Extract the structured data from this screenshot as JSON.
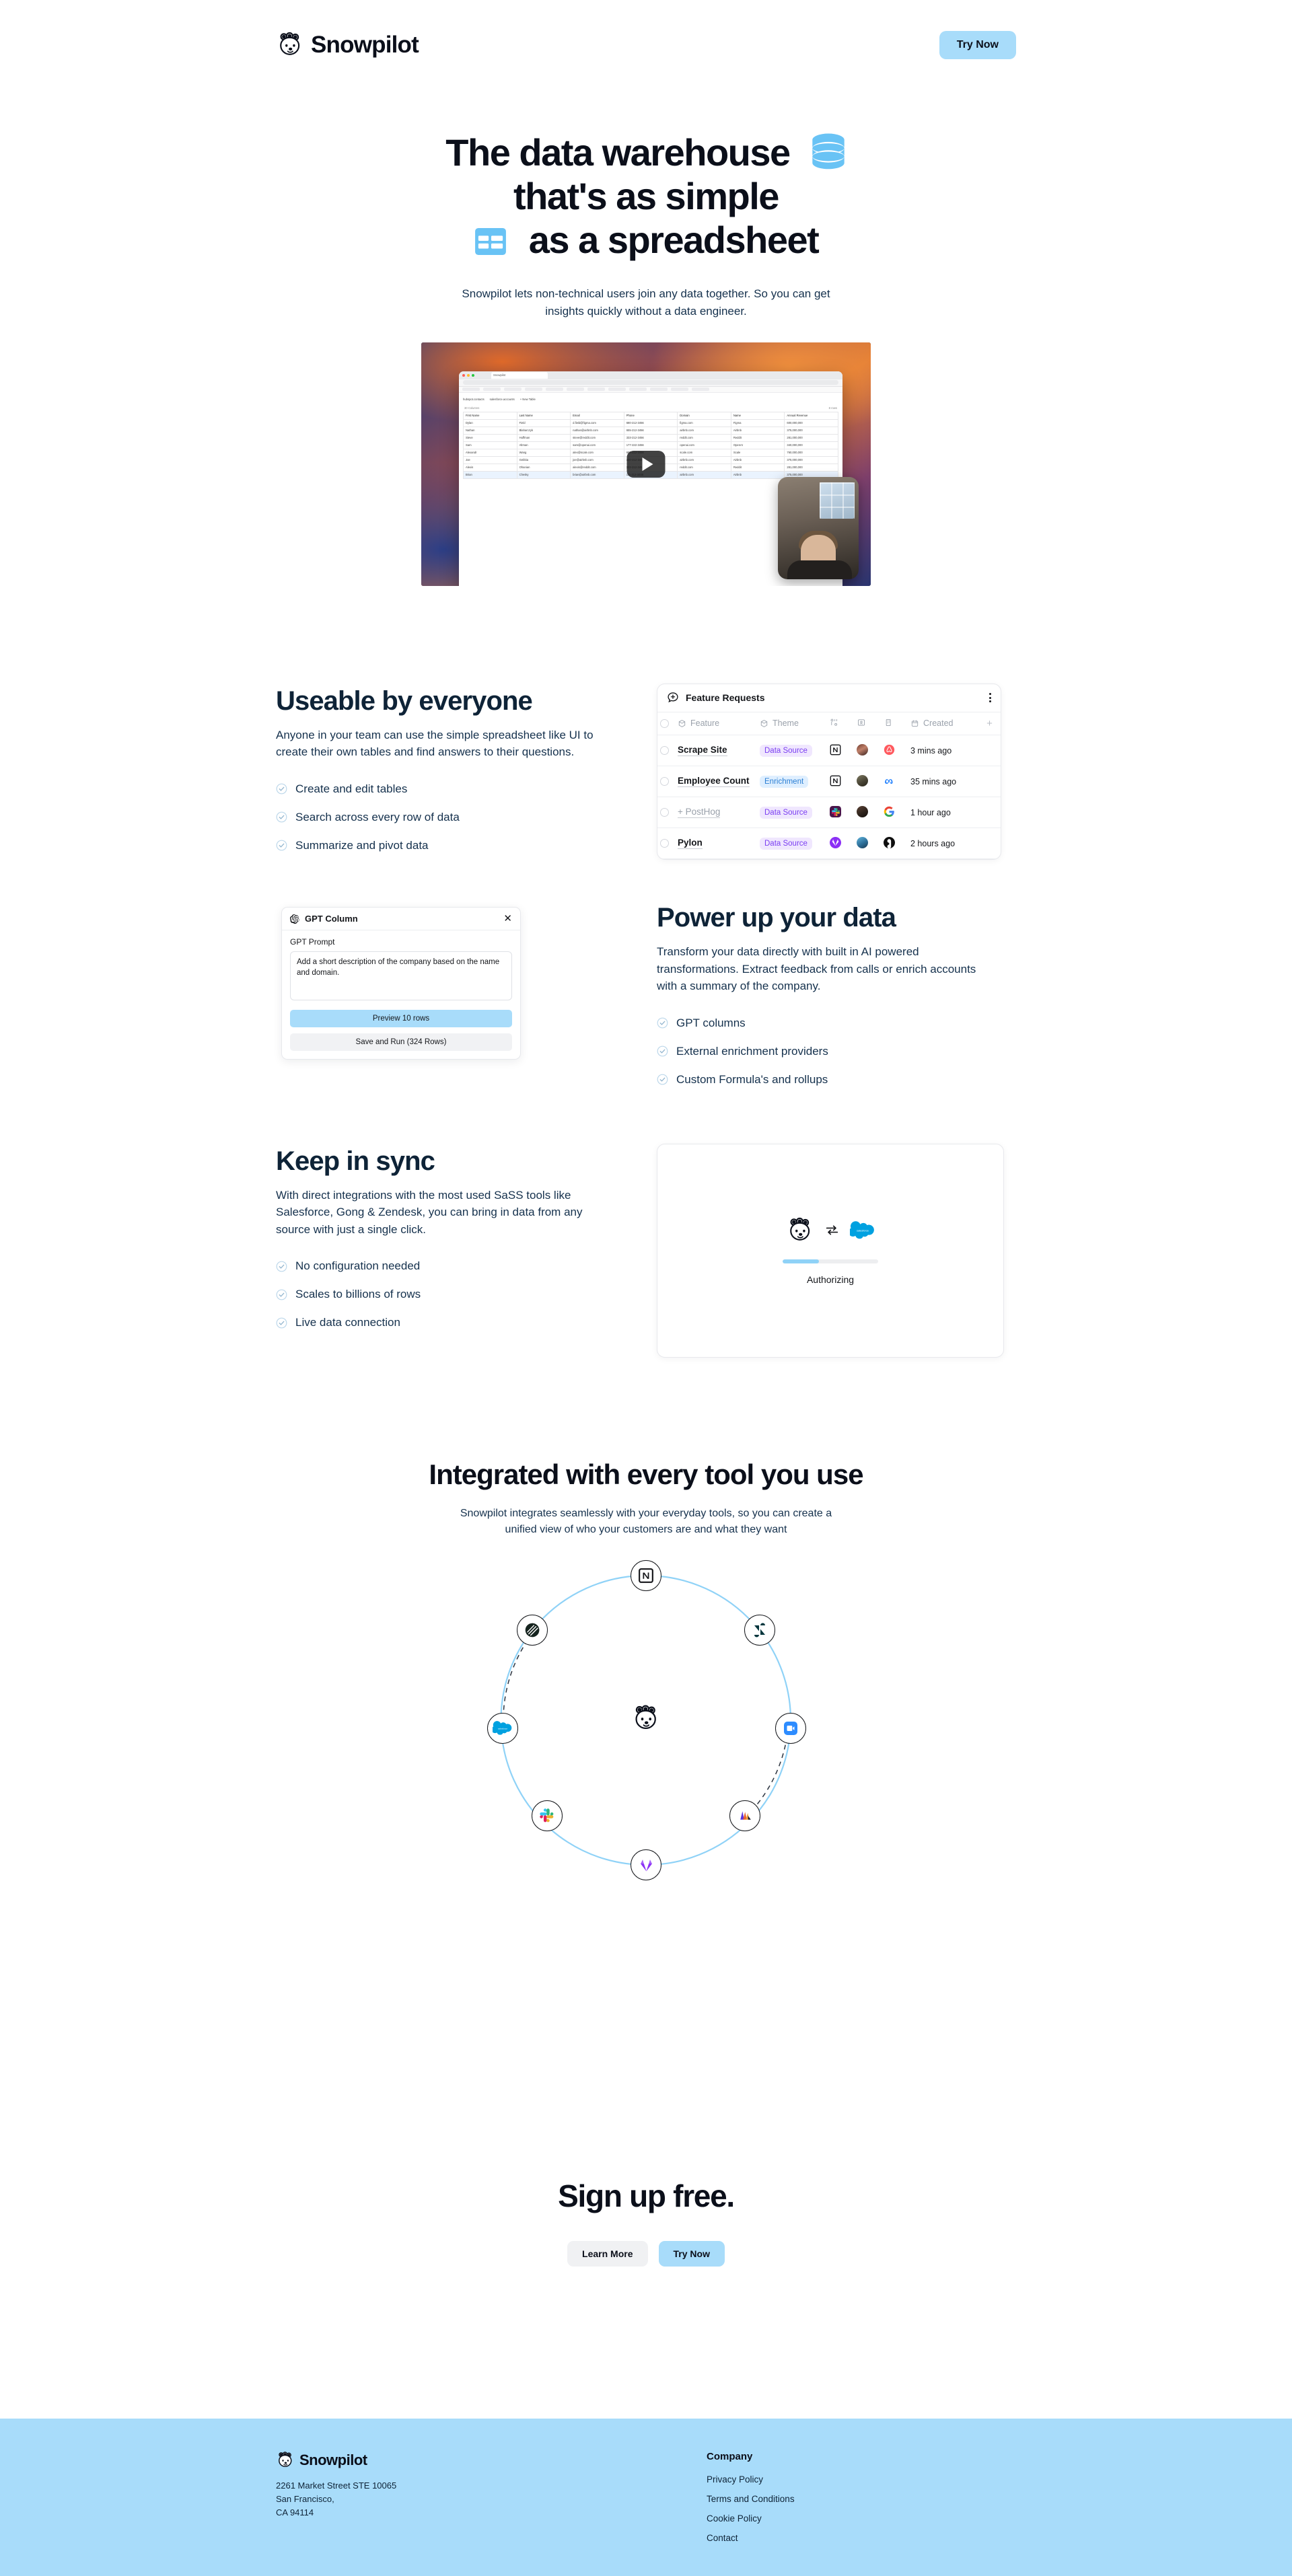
{
  "brand": {
    "name": "Snowpilot",
    "logo_icon": "snowpilot-bear-logo"
  },
  "header": {
    "cta_label": "Try Now"
  },
  "hero": {
    "title_line1": "The data warehouse",
    "title_line2": "that's as simple",
    "title_line3": "as a spreadsheet",
    "database_icon": "database-icon",
    "spreadsheet_icon": "spreadsheet-icon",
    "subtitle": "Snowpilot lets non-technical users join any data together. So you can get insights quickly without a data engineer.",
    "video": {
      "play_icon": "play-button-icon",
      "browser": {
        "tab_title": "Snowpilot",
        "url": "https://app.snowpilot.com/table/hubspot.contacts",
        "app_tabs": [
          "hubspot.contacts",
          "salesforce.accounts",
          "+ New Table"
        ],
        "columns_label": "30 Columns",
        "rows_label": "8 rows",
        "headers": [
          "First Name",
          "Last Name",
          "Email",
          "Phone",
          "Domain",
          "Name",
          "Annual Revenue"
        ],
        "rows": [
          [
            "Dylan",
            "Field",
            "d.field@figma.com",
            "680-212-3456",
            "figma.com",
            "Figma",
            "600,000,000"
          ],
          [
            "Nathan",
            "Blaharczyk",
            "nathan@airbnb.com",
            "655-212-3456",
            "airbnb.com",
            "Airbnb",
            "375,000,000"
          ],
          [
            "Steve",
            "Huffman",
            "steve@reddit.com",
            "333-212-3456",
            "reddit.com",
            "Reddit",
            "281,000,000"
          ],
          [
            "Sam",
            "Altman",
            "sam@openai.com",
            "177-222-3456",
            "openai.com",
            "OpenAI",
            "340,000,000"
          ],
          [
            "Alexandr",
            "Wang",
            "alex@scale.com",
            "680-212-3456",
            "scale.com",
            "Scale",
            "760,000,000"
          ],
          [
            "Joe",
            "Gebbia",
            "joe@airbnb.com",
            "440-212-3456",
            "airbnb.com",
            "Airbnb",
            "375,000,000"
          ],
          [
            "Alexis",
            "Ohanian",
            "alexis@reddit.com",
            "322-212-3456",
            "reddit.com",
            "Reddit",
            "281,000,000"
          ],
          [
            "Brian",
            "Chesky",
            "brian@airbnb.com",
            "111-212-3456",
            "airbnb.com",
            "Airbnb",
            "375,000,000"
          ]
        ]
      }
    }
  },
  "sections": [
    {
      "id": "useable",
      "heading": "Useable by everyone",
      "body": "Anyone in your team can use the simple spreadsheet like UI to create their own tables and find answers to their questions.",
      "checks": [
        "Create and edit tables",
        "Search across every row of data",
        "Summarize and pivot data"
      ]
    },
    {
      "id": "power",
      "heading": "Power up your data",
      "body": "Transform your data directly with built in AI powered transformations. Extract feedback from calls or enrich accounts with a summary of the company.",
      "checks": [
        "GPT columns",
        "External enrichment providers",
        "Custom Formula's and rollups"
      ]
    },
    {
      "id": "sync",
      "heading": "Keep in sync",
      "body": "With direct integrations with the most used SaSS tools like Salesforce, Gong & Zendesk, you can bring in data from any source with just a single click.",
      "checks": [
        "No configuration needed",
        "Scales to billions of rows",
        "Live data connection"
      ]
    }
  ],
  "feature_requests": {
    "title": "Feature Requests",
    "title_icon": "comment-plus-icon",
    "menu_icon": "three-dots-menu-icon",
    "add_column_icon": "plus-icon",
    "headers": [
      {
        "label": "Feature",
        "icon": "box-icon"
      },
      {
        "label": "Theme",
        "icon": "box-icon"
      },
      {
        "label": "",
        "icon": "connector-icon"
      },
      {
        "label": "",
        "icon": "person-card-icon"
      },
      {
        "label": "",
        "icon": "building-icon"
      },
      {
        "label": "Created",
        "icon": "calendar-icon"
      }
    ],
    "rows": [
      {
        "feature": "Scrape Site",
        "muted": false,
        "theme": "Data Source",
        "theme_type": "ds",
        "tool_icon": "notion-icon",
        "avatar": "avatar-woman-1",
        "company_icon": "airbnb-icon",
        "created": "3 mins ago"
      },
      {
        "feature": "Employee Count",
        "muted": false,
        "theme": "Enrichment",
        "theme_type": "en",
        "tool_icon": "notion-icon",
        "avatar": "avatar-man-1",
        "company_icon": "meta-icon",
        "created": "35 mins ago"
      },
      {
        "feature": "+ PostHog",
        "muted": true,
        "theme": "Data Source",
        "theme_type": "ds",
        "tool_icon": "slack-icon",
        "avatar": "avatar-man-2",
        "company_icon": "google-icon",
        "created": "1 hour ago"
      },
      {
        "feature": "Pylon",
        "muted": false,
        "theme": "Data Source",
        "theme_type": "ds",
        "tool_icon": "gitlab-icon",
        "avatar": "avatar-woman-2",
        "company_icon": "figma-icon",
        "created": "2 hours ago"
      }
    ]
  },
  "gpt_column": {
    "title": "GPT Column",
    "title_icon": "openai-icon",
    "close_icon": "close-icon",
    "prompt_label": "GPT Prompt",
    "prompt_value": "Add a short description of the company based on the name and domain.",
    "preview_button": "Preview 10 rows",
    "save_button": "Save and Run (324 Rows)"
  },
  "sync_card": {
    "left_icon": "snowpilot-bear-logo",
    "exchange_icon": "bidirectional-arrows-icon",
    "right_icon": "salesforce-icon",
    "progress_percent": 38,
    "status_label": "Authorizing"
  },
  "integrations": {
    "heading": "Integrated with every tool you use",
    "subtitle": "Snowpilot integrates seamlessly with your everyday tools, so you can create a unified view of who your customers are and what they want",
    "center_icon": "snowpilot-bear-logo",
    "nodes": [
      {
        "icon": "notion-icon",
        "angle": -90
      },
      {
        "icon": "zendesk-icon",
        "angle": -38
      },
      {
        "icon": "zoom-icon",
        "angle": 3
      },
      {
        "icon": "gong-icon",
        "angle": 52
      },
      {
        "icon": "gitlab-icon",
        "angle": 90
      },
      {
        "icon": "slack-icon",
        "angle": 128
      },
      {
        "icon": "salesforce-icon",
        "angle": 177
      },
      {
        "icon": "snowflake-dark-icon",
        "angle": -142
      }
    ]
  },
  "signup": {
    "heading": "Sign up free.",
    "learn_more_label": "Learn More",
    "try_now_label": "Try Now"
  },
  "footer": {
    "brand": "Snowpilot",
    "address_line1": "2261 Market Street STE 10065",
    "address_line2": "San Francisco,",
    "address_line3": "CA 94114",
    "column_title": "Company",
    "links": [
      "Privacy Policy",
      "Terms and Conditions",
      "Cookie Policy",
      "Contact"
    ]
  },
  "colors": {
    "accent": "#a8dcfa",
    "ink": "#0e2337",
    "tag_data_source_bg": "#f0e7fe",
    "tag_data_source_fg": "#7b3ff2",
    "tag_enrichment_bg": "#dfefff",
    "tag_enrichment_fg": "#2b7fd4",
    "orbit_stroke": "#8fd2f7"
  }
}
